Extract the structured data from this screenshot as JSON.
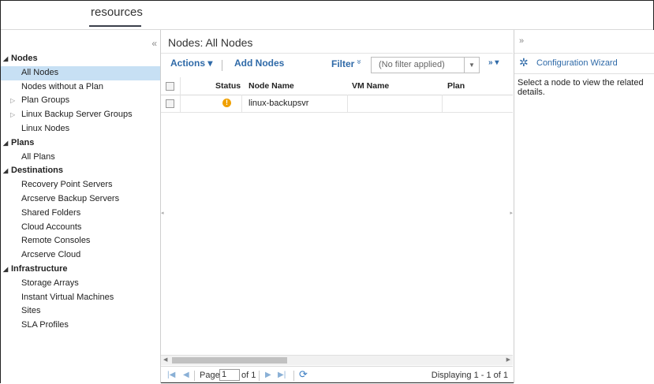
{
  "top_tab": {
    "label": "resources"
  },
  "left_nav": {
    "collapse_glyph": "«",
    "tree": [
      {
        "label": "Nodes",
        "type": "section"
      },
      {
        "label": "All Nodes",
        "type": "item",
        "selected": true
      },
      {
        "label": "Nodes without a Plan",
        "type": "item"
      },
      {
        "label": "Plan Groups",
        "type": "item",
        "expandable": true
      },
      {
        "label": "Linux Backup Server Groups",
        "type": "item",
        "expandable": true
      },
      {
        "label": "Linux Nodes",
        "type": "item"
      },
      {
        "label": "Plans",
        "type": "section"
      },
      {
        "label": "All Plans",
        "type": "item"
      },
      {
        "label": "Destinations",
        "type": "section"
      },
      {
        "label": "Recovery Point Servers",
        "type": "item"
      },
      {
        "label": "Arcserve Backup Servers",
        "type": "item"
      },
      {
        "label": "Shared Folders",
        "type": "item"
      },
      {
        "label": "Cloud Accounts",
        "type": "item"
      },
      {
        "label": "Remote Consoles",
        "type": "item"
      },
      {
        "label": "Arcserve Cloud",
        "type": "item"
      },
      {
        "label": "Infrastructure",
        "type": "section"
      },
      {
        "label": "Storage Arrays",
        "type": "item"
      },
      {
        "label": "Instant Virtual Machines",
        "type": "item"
      },
      {
        "label": "Sites",
        "type": "item"
      },
      {
        "label": "SLA Profiles",
        "type": "item"
      }
    ]
  },
  "center": {
    "title": "Nodes: All Nodes",
    "toolbar": {
      "actions": "Actions ▾",
      "add_nodes": "Add Nodes",
      "filter": "Filter",
      "filter_icon": "»",
      "filter_value": "(No filter applied)",
      "more": "» ▾"
    },
    "columns": {
      "status": "Status",
      "node_name": "Node Name",
      "vm_name": "VM Name",
      "plan": "Plan"
    },
    "rows": [
      {
        "status_icon": "warning-icon",
        "status_glyph": "!",
        "node_name": "linux-backupsvr",
        "vm_name": "",
        "plan": ""
      }
    ],
    "pager": {
      "page_label": "Page",
      "page_value": "1",
      "of_label": "of 1",
      "display": "Displaying 1 - 1 of 1"
    }
  },
  "right_panel": {
    "collapse_glyph": "»",
    "wizard_label": "Configuration Wizard",
    "message": "Select a node to view the related details."
  },
  "colors": {
    "link_blue": "#2f6aa8",
    "selected_row": "#c7e0f4",
    "warning": "#f0a000"
  }
}
